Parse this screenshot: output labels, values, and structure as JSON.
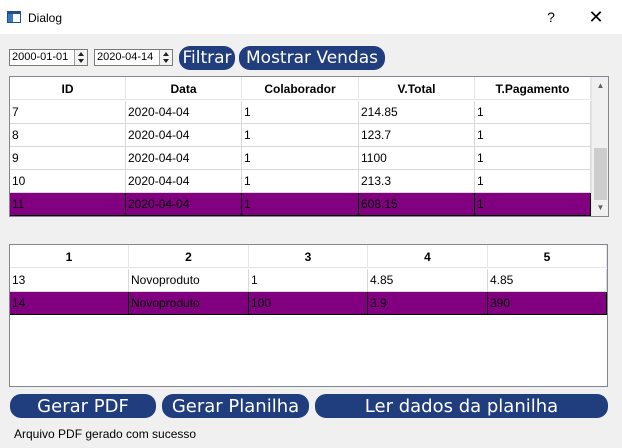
{
  "window": {
    "title": "Dialog",
    "help_label": "?",
    "close_label": "✕"
  },
  "filters": {
    "date_from": "2000-01-01",
    "date_to": "2020-04-14",
    "filter_label": "Filtrar",
    "show_sales_label": "Mostrar Vendas"
  },
  "sales_table": {
    "columns": [
      "ID",
      "Data",
      "Colaborador",
      "V.Total",
      "T.Pagamento"
    ],
    "rows": [
      [
        "7",
        "2020-04-04",
        "1",
        "214.85",
        "1"
      ],
      [
        "8",
        "2020-04-04",
        "1",
        "123.7",
        "1"
      ],
      [
        "9",
        "2020-04-04",
        "1",
        "1100",
        "1"
      ],
      [
        "10",
        "2020-04-04",
        "1",
        "213.3",
        "1"
      ],
      [
        "11",
        "2020-04-04",
        "1",
        "608.15",
        "1"
      ]
    ],
    "selected_row": 4,
    "scrollbar": {
      "up_icon": "▲",
      "down_icon": "▼"
    }
  },
  "items_table": {
    "columns": [
      "1",
      "2",
      "3",
      "4",
      "5"
    ],
    "rows": [
      [
        "13",
        "Novoproduto",
        "1",
        "4.85",
        "4.85"
      ],
      [
        "14",
        "Novoproduto",
        "100",
        "3.9",
        "390"
      ]
    ],
    "selected_row": 1
  },
  "actions": {
    "generate_pdf_label": "Gerar PDF",
    "generate_sheet_label": "Gerar Planilha",
    "read_sheet_label": "Ler dados da planilha"
  },
  "status": {
    "message": "Arquivo PDF gerado com sucesso"
  },
  "colors": {
    "button_bg": "#203d7e",
    "selection": "#800080"
  }
}
